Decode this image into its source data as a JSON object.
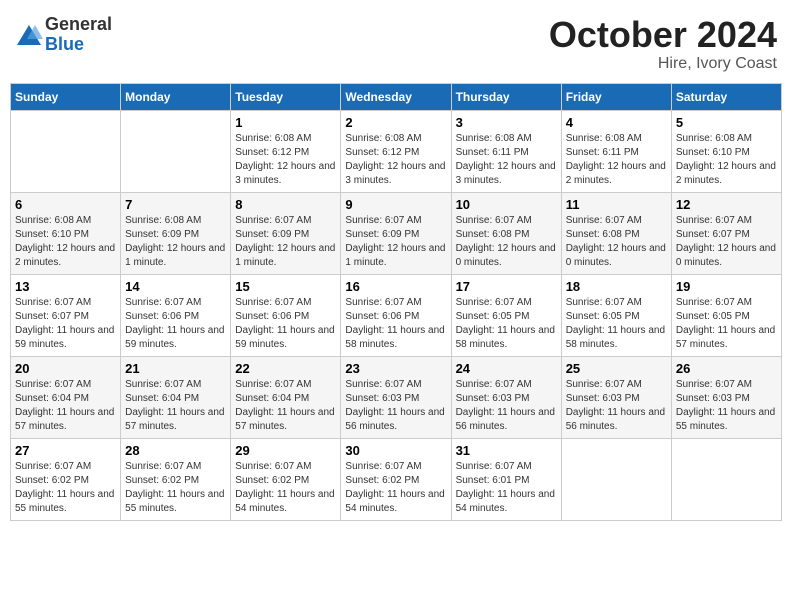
{
  "logo": {
    "general": "General",
    "blue": "Blue"
  },
  "header": {
    "month": "October 2024",
    "location": "Hire, Ivory Coast"
  },
  "weekdays": [
    "Sunday",
    "Monday",
    "Tuesday",
    "Wednesday",
    "Thursday",
    "Friday",
    "Saturday"
  ],
  "weeks": [
    [
      {
        "day": "",
        "info": ""
      },
      {
        "day": "",
        "info": ""
      },
      {
        "day": "1",
        "info": "Sunrise: 6:08 AM\nSunset: 6:12 PM\nDaylight: 12 hours and 3 minutes."
      },
      {
        "day": "2",
        "info": "Sunrise: 6:08 AM\nSunset: 6:12 PM\nDaylight: 12 hours and 3 minutes."
      },
      {
        "day": "3",
        "info": "Sunrise: 6:08 AM\nSunset: 6:11 PM\nDaylight: 12 hours and 3 minutes."
      },
      {
        "day": "4",
        "info": "Sunrise: 6:08 AM\nSunset: 6:11 PM\nDaylight: 12 hours and 2 minutes."
      },
      {
        "day": "5",
        "info": "Sunrise: 6:08 AM\nSunset: 6:10 PM\nDaylight: 12 hours and 2 minutes."
      }
    ],
    [
      {
        "day": "6",
        "info": "Sunrise: 6:08 AM\nSunset: 6:10 PM\nDaylight: 12 hours and 2 minutes."
      },
      {
        "day": "7",
        "info": "Sunrise: 6:08 AM\nSunset: 6:09 PM\nDaylight: 12 hours and 1 minute."
      },
      {
        "day": "8",
        "info": "Sunrise: 6:07 AM\nSunset: 6:09 PM\nDaylight: 12 hours and 1 minute."
      },
      {
        "day": "9",
        "info": "Sunrise: 6:07 AM\nSunset: 6:09 PM\nDaylight: 12 hours and 1 minute."
      },
      {
        "day": "10",
        "info": "Sunrise: 6:07 AM\nSunset: 6:08 PM\nDaylight: 12 hours and 0 minutes."
      },
      {
        "day": "11",
        "info": "Sunrise: 6:07 AM\nSunset: 6:08 PM\nDaylight: 12 hours and 0 minutes."
      },
      {
        "day": "12",
        "info": "Sunrise: 6:07 AM\nSunset: 6:07 PM\nDaylight: 12 hours and 0 minutes."
      }
    ],
    [
      {
        "day": "13",
        "info": "Sunrise: 6:07 AM\nSunset: 6:07 PM\nDaylight: 11 hours and 59 minutes."
      },
      {
        "day": "14",
        "info": "Sunrise: 6:07 AM\nSunset: 6:06 PM\nDaylight: 11 hours and 59 minutes."
      },
      {
        "day": "15",
        "info": "Sunrise: 6:07 AM\nSunset: 6:06 PM\nDaylight: 11 hours and 59 minutes."
      },
      {
        "day": "16",
        "info": "Sunrise: 6:07 AM\nSunset: 6:06 PM\nDaylight: 11 hours and 58 minutes."
      },
      {
        "day": "17",
        "info": "Sunrise: 6:07 AM\nSunset: 6:05 PM\nDaylight: 11 hours and 58 minutes."
      },
      {
        "day": "18",
        "info": "Sunrise: 6:07 AM\nSunset: 6:05 PM\nDaylight: 11 hours and 58 minutes."
      },
      {
        "day": "19",
        "info": "Sunrise: 6:07 AM\nSunset: 6:05 PM\nDaylight: 11 hours and 57 minutes."
      }
    ],
    [
      {
        "day": "20",
        "info": "Sunrise: 6:07 AM\nSunset: 6:04 PM\nDaylight: 11 hours and 57 minutes."
      },
      {
        "day": "21",
        "info": "Sunrise: 6:07 AM\nSunset: 6:04 PM\nDaylight: 11 hours and 57 minutes."
      },
      {
        "day": "22",
        "info": "Sunrise: 6:07 AM\nSunset: 6:04 PM\nDaylight: 11 hours and 57 minutes."
      },
      {
        "day": "23",
        "info": "Sunrise: 6:07 AM\nSunset: 6:03 PM\nDaylight: 11 hours and 56 minutes."
      },
      {
        "day": "24",
        "info": "Sunrise: 6:07 AM\nSunset: 6:03 PM\nDaylight: 11 hours and 56 minutes."
      },
      {
        "day": "25",
        "info": "Sunrise: 6:07 AM\nSunset: 6:03 PM\nDaylight: 11 hours and 56 minutes."
      },
      {
        "day": "26",
        "info": "Sunrise: 6:07 AM\nSunset: 6:03 PM\nDaylight: 11 hours and 55 minutes."
      }
    ],
    [
      {
        "day": "27",
        "info": "Sunrise: 6:07 AM\nSunset: 6:02 PM\nDaylight: 11 hours and 55 minutes."
      },
      {
        "day": "28",
        "info": "Sunrise: 6:07 AM\nSunset: 6:02 PM\nDaylight: 11 hours and 55 minutes."
      },
      {
        "day": "29",
        "info": "Sunrise: 6:07 AM\nSunset: 6:02 PM\nDaylight: 11 hours and 54 minutes."
      },
      {
        "day": "30",
        "info": "Sunrise: 6:07 AM\nSunset: 6:02 PM\nDaylight: 11 hours and 54 minutes."
      },
      {
        "day": "31",
        "info": "Sunrise: 6:07 AM\nSunset: 6:01 PM\nDaylight: 11 hours and 54 minutes."
      },
      {
        "day": "",
        "info": ""
      },
      {
        "day": "",
        "info": ""
      }
    ]
  ]
}
